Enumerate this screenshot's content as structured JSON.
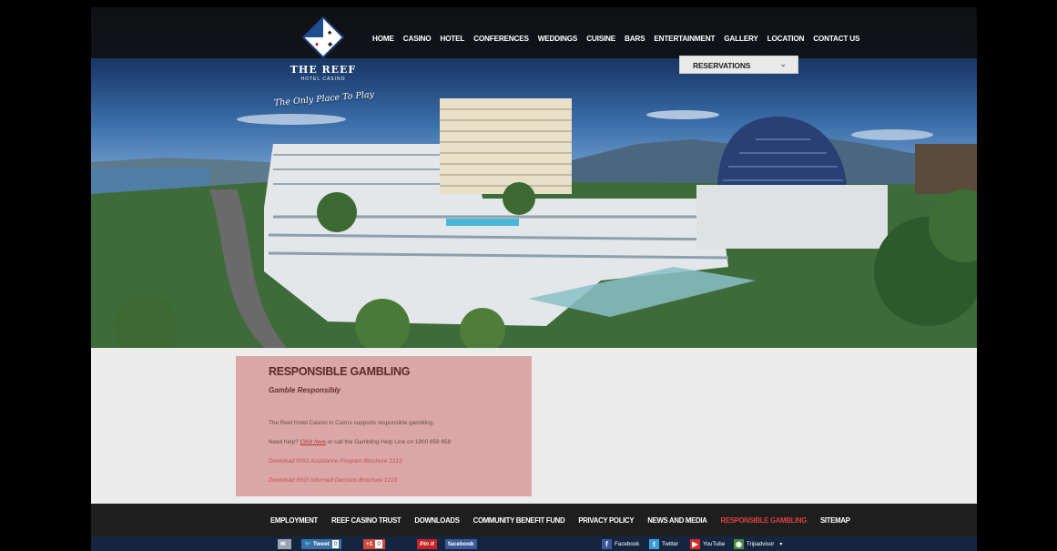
{
  "brand": {
    "name": "THE REEF",
    "subname": "HOTEL CASINO",
    "tagline": "The Only Place To Play"
  },
  "nav": [
    "HOME",
    "CASINO",
    "HOTEL",
    "CONFERENCES",
    "WEDDINGS",
    "CUISINE",
    "BARS",
    "ENTERTAINMENT",
    "GALLERY",
    "LOCATION",
    "CONTACT US"
  ],
  "reservations": {
    "label": "RESERVATIONS"
  },
  "content": {
    "title": "RESPONSIBLE GAMBLING",
    "subtitle": "Gamble Responsibly",
    "para1": "The Reef Hotel Casino in Cairns supports responsible gambling.",
    "para2_before": "Need help? ",
    "para2_link": "Click here",
    "para2_after": " or call the Gambling Help Line on 1800 858 858",
    "link1": "Download RSG Assistance Program Brochure 1213",
    "link2": "Download RSG Informed Decision Brochure 1213"
  },
  "footer": {
    "links": [
      "EMPLOYMENT",
      "REEF CASINO TRUST",
      "DOWNLOADS",
      "COMMUNITY BENEFIT FUND",
      "PRIVACY POLICY",
      "NEWS AND MEDIA",
      "RESPONSIBLE GAMBLING",
      "SITEMAP"
    ],
    "active": "RESPONSIBLE GAMBLING"
  },
  "share": {
    "tweet_label": "Tweet",
    "tweet_count": "0",
    "gplus_label": "+1",
    "gplus_count": "0",
    "pinit_label": "Pin it",
    "facebook_label": "facebook"
  },
  "social": {
    "facebook": "Facebook",
    "twitter": "Twitter",
    "youtube": "YouTube",
    "tripadvisor": "Tripadvisor"
  },
  "colors": {
    "accent": "#d94040",
    "panel": "#dba6a6",
    "bar": "#1e1e1e"
  }
}
